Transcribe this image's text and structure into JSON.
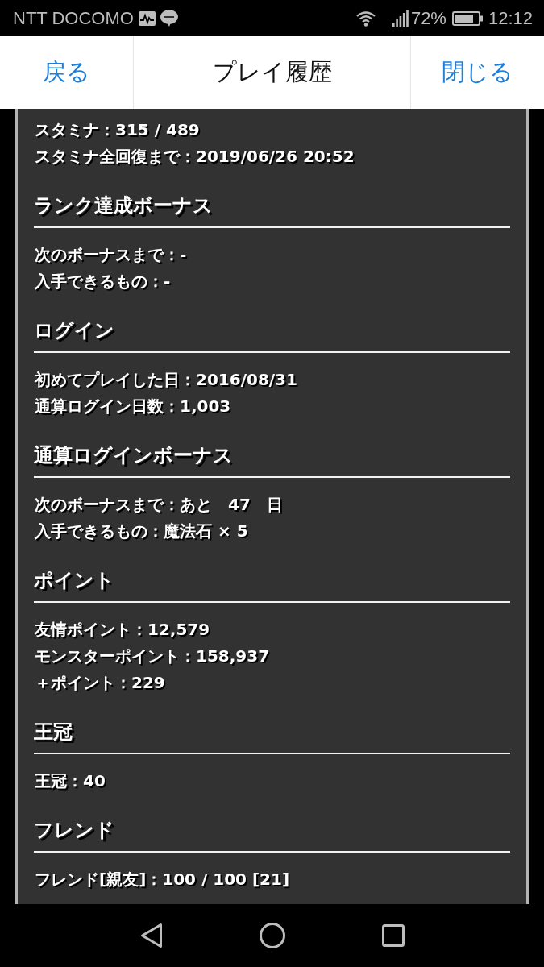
{
  "status_bar": {
    "carrier": "NTT DOCOMO",
    "battery": "72%",
    "time": "12:12"
  },
  "header": {
    "back": "戻る",
    "title": "プレイ履歴",
    "close": "閉じる"
  },
  "intro_lines": [
    "スタミナ：315 / 489",
    "スタミナ全回復まで：2019/06/26 20:52"
  ],
  "sections": [
    {
      "heading": "ランク達成ボーナス",
      "lines": [
        "次のボーナスまで：-",
        "入手できるもの：-"
      ]
    },
    {
      "heading": "ログイン",
      "lines": [
        "初めてプレイした日：2016/08/31",
        "通算ログイン日数：1,003"
      ]
    },
    {
      "heading": "通算ログインボーナス",
      "lines": [
        "次のボーナスまで：あと　47　日",
        "入手できるもの：魔法石 × 5"
      ]
    },
    {
      "heading": "ポイント",
      "lines": [
        "友情ポイント：12,579",
        "モンスターポイント：158,937",
        "＋ポイント：229"
      ]
    },
    {
      "heading": "王冠",
      "lines": [
        "王冠：40"
      ]
    },
    {
      "heading": "フレンド",
      "lines": [
        "フレンド[親友]：100 / 100 [21]"
      ]
    }
  ]
}
